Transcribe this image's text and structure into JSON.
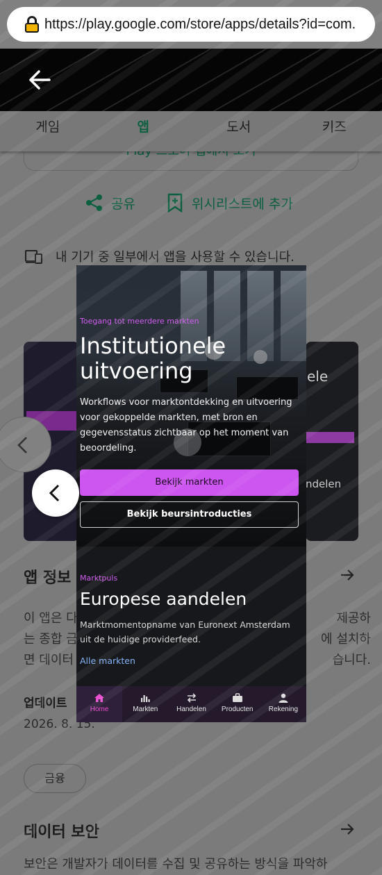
{
  "browser": {
    "url": "https://play.google.com/store/apps/details?id=com."
  },
  "tabs": [
    {
      "label": "게임",
      "active": false
    },
    {
      "label": "앱",
      "active": true
    },
    {
      "label": "도서",
      "active": false
    },
    {
      "label": "키즈",
      "active": false
    }
  ],
  "store": {
    "install_label": "Play 스토어 앱에서 보기",
    "share_label": "공유",
    "wishlist_label": "위시리스트에 추가",
    "device_note": "내 기기 중 일부에서 앱을 사용할 수 있습니다.",
    "about_title": "앱 정보",
    "about_line1": "이 앱은 다",
    "about_line1_right": "제공하",
    "about_line2": "는 종합 금",
    "about_line2_right": "에 설치하",
    "about_line3": "면 데이터",
    "about_line3_right": "습니다.",
    "updated_label": "업데이트",
    "updated_date": "2026. 8. 15.",
    "category_chip": "금융",
    "data_safety_title": "데이터 보안",
    "data_safety_text": "보안은 개발자가 데이터를 수집 및 공유하는 방식을 파악하"
  },
  "side_shot_right": {
    "title_fragment": "ele",
    "footer_fragment": "ndelen"
  },
  "app_screenshot": {
    "hero": {
      "eyebrow": "Toegang tot meerdere markten",
      "title": "Institutionele uitvoering",
      "body": "Workflows voor marktontdekking en uitvoering voor gekoppelde markten, met bron en gegevensstatus zichtbaar op het moment van beoordeling.",
      "primary_button": "Bekijk markten",
      "secondary_button": "Bekijk beursintroducties"
    },
    "pulse": {
      "eyebrow": "Marktpuls",
      "title": "Europese aandelen",
      "body": "Marktmomentopname van Euronext Amsterdam uit de huidige providerfeed.",
      "link": "Alle markten"
    },
    "bottom_nav": [
      {
        "label": "Home",
        "icon": "home-icon",
        "active": true
      },
      {
        "label": "Markten",
        "icon": "chart-icon",
        "active": false
      },
      {
        "label": "Handelen",
        "icon": "swap-icon",
        "active": false
      },
      {
        "label": "Producten",
        "icon": "briefcase-icon",
        "active": false
      },
      {
        "label": "Rekening",
        "icon": "person-icon",
        "active": false
      }
    ]
  },
  "colors": {
    "accent_green": "#0c5f3f",
    "app_accent_purple": "#cd55f0",
    "app_active_pink": "#e84fd0",
    "app_link_blue": "#87b3f7"
  }
}
